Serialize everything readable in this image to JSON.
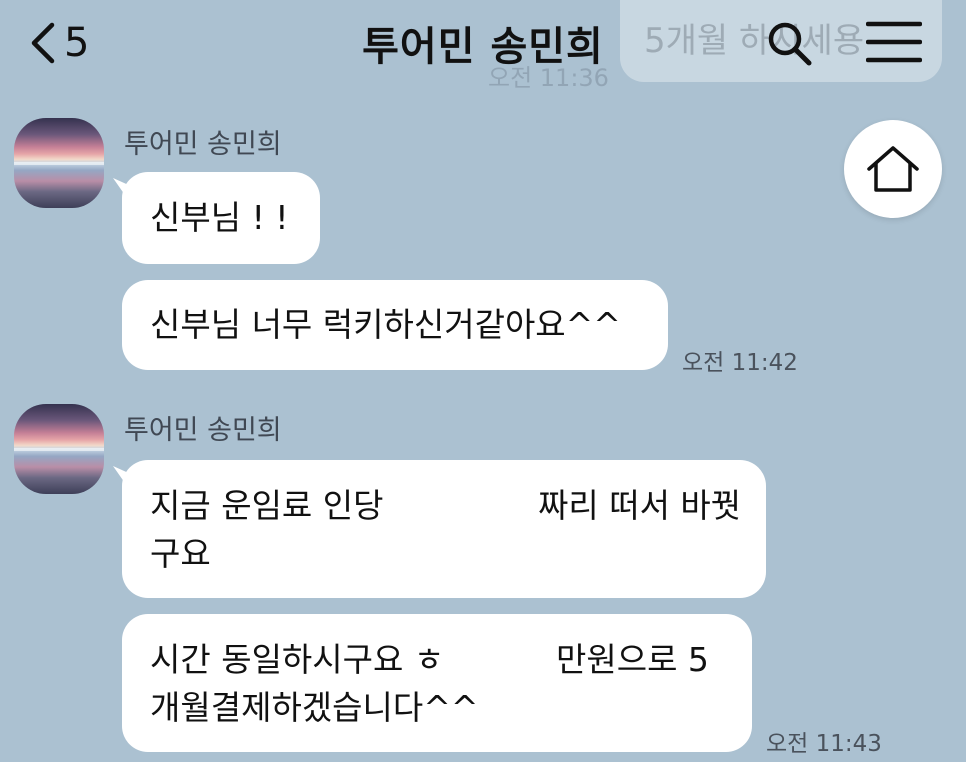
{
  "header": {
    "back_count": "5",
    "title": "투어민 송민희",
    "ghost_preview_text": "5개월 하시세용",
    "ghost_preview_time": "오전 11:36"
  },
  "messages": [
    {
      "sender": "투어민 송민희",
      "bubbles": [
        {
          "text": "신부님 ! !"
        },
        {
          "text": "신부님 너무 럭키하신거같아요^^",
          "time": "오전 11:42"
        }
      ]
    },
    {
      "sender": "투어민 송민희",
      "bubbles": [
        {
          "line1a": "지금 운임료 인당",
          "line1b": "짜리 떠서 바꿧",
          "line2": "구요"
        },
        {
          "line1a": "시간 동일하시구요 ㅎ",
          "line1b": "만원으로 5",
          "line2": "개월결제하겠습니다^^",
          "time": "오전 11:43"
        }
      ]
    }
  ],
  "icons": {
    "back": "chevron-left-icon",
    "search": "search-icon",
    "menu": "hamburger-menu-icon",
    "home": "home-icon"
  },
  "colors": {
    "background": "#abc1d1",
    "bubble": "#ffffff",
    "text": "#111111"
  }
}
